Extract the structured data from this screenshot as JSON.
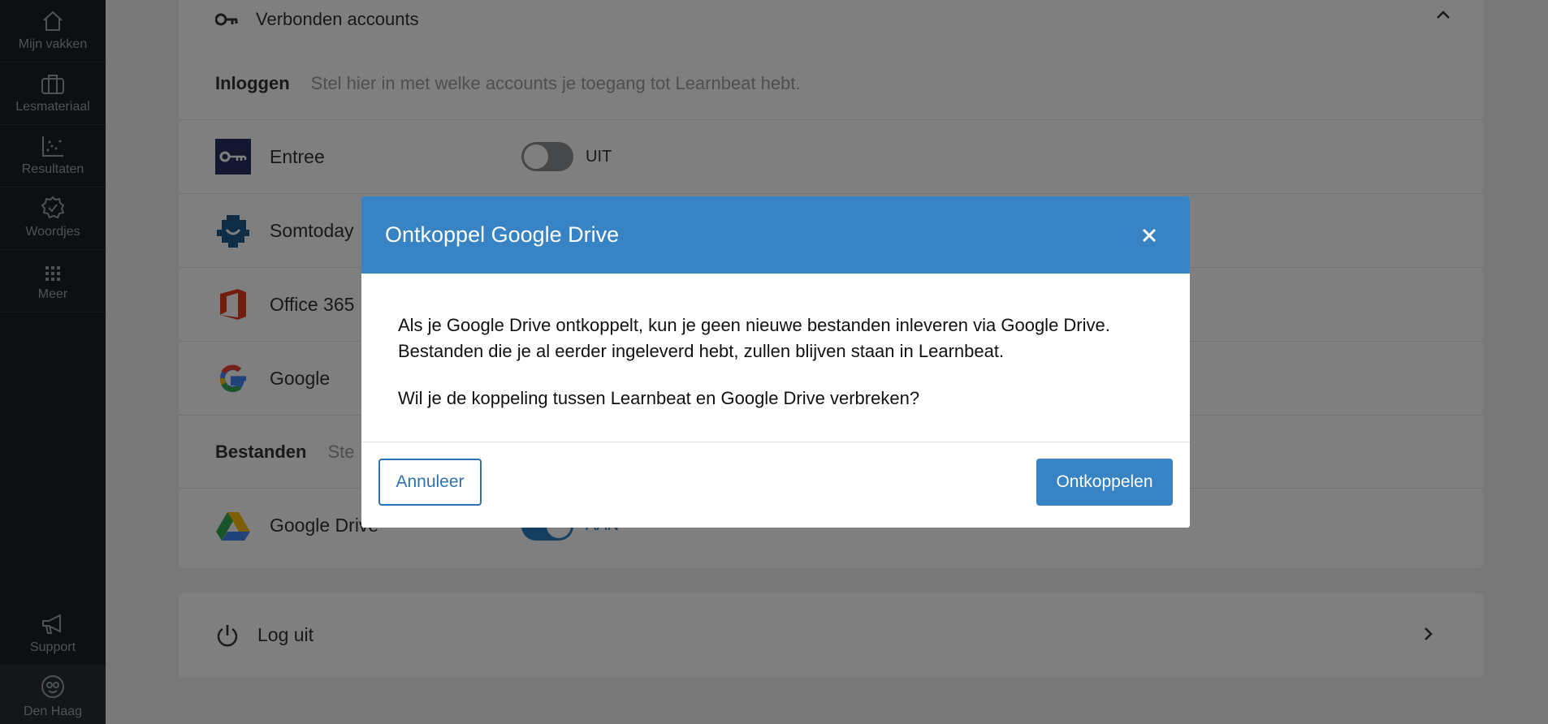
{
  "sidebar": {
    "items": [
      {
        "label": "Mijn vakken",
        "icon": "home-icon"
      },
      {
        "label": "Lesmateriaal",
        "icon": "briefcase-icon"
      },
      {
        "label": "Resultaten",
        "icon": "chart-icon"
      },
      {
        "label": "Woordjes",
        "icon": "badge-check-icon"
      },
      {
        "label": "Meer",
        "icon": "grid-icon"
      }
    ],
    "support_label": "Support",
    "profile_label": "Den Haag"
  },
  "settings": {
    "header": "Verbonden accounts",
    "login_section": {
      "title": "Inloggen",
      "desc": "Stel hier in met welke accounts je toegang tot Learnbeat hebt."
    },
    "accounts": [
      {
        "name": "Entree",
        "toggle_label": "UIT"
      },
      {
        "name": "Somtoday"
      },
      {
        "name": "Office 365"
      },
      {
        "name": "Google"
      }
    ],
    "files_section": {
      "title": "Bestanden",
      "desc": "Ste"
    },
    "files": [
      {
        "name": "Google Drive",
        "toggle_label": "AAN"
      }
    ],
    "logout_label": "Log uit"
  },
  "modal": {
    "title": "Ontkoppel Google Drive",
    "body_1": "Als je Google Drive ontkoppelt, kun je geen nieuwe bestanden inleveren via Google Drive. Bestanden die je al eerder ingeleverd hebt, zullen blijven staan in Learnbeat.",
    "body_2": "Wil je de koppeling tussen Learnbeat en Google Drive verbreken?",
    "cancel_label": "Annuleer",
    "confirm_label": "Ontkoppelen"
  },
  "colors": {
    "primary": "#3883c4",
    "sidebar": "#1b1e22"
  }
}
